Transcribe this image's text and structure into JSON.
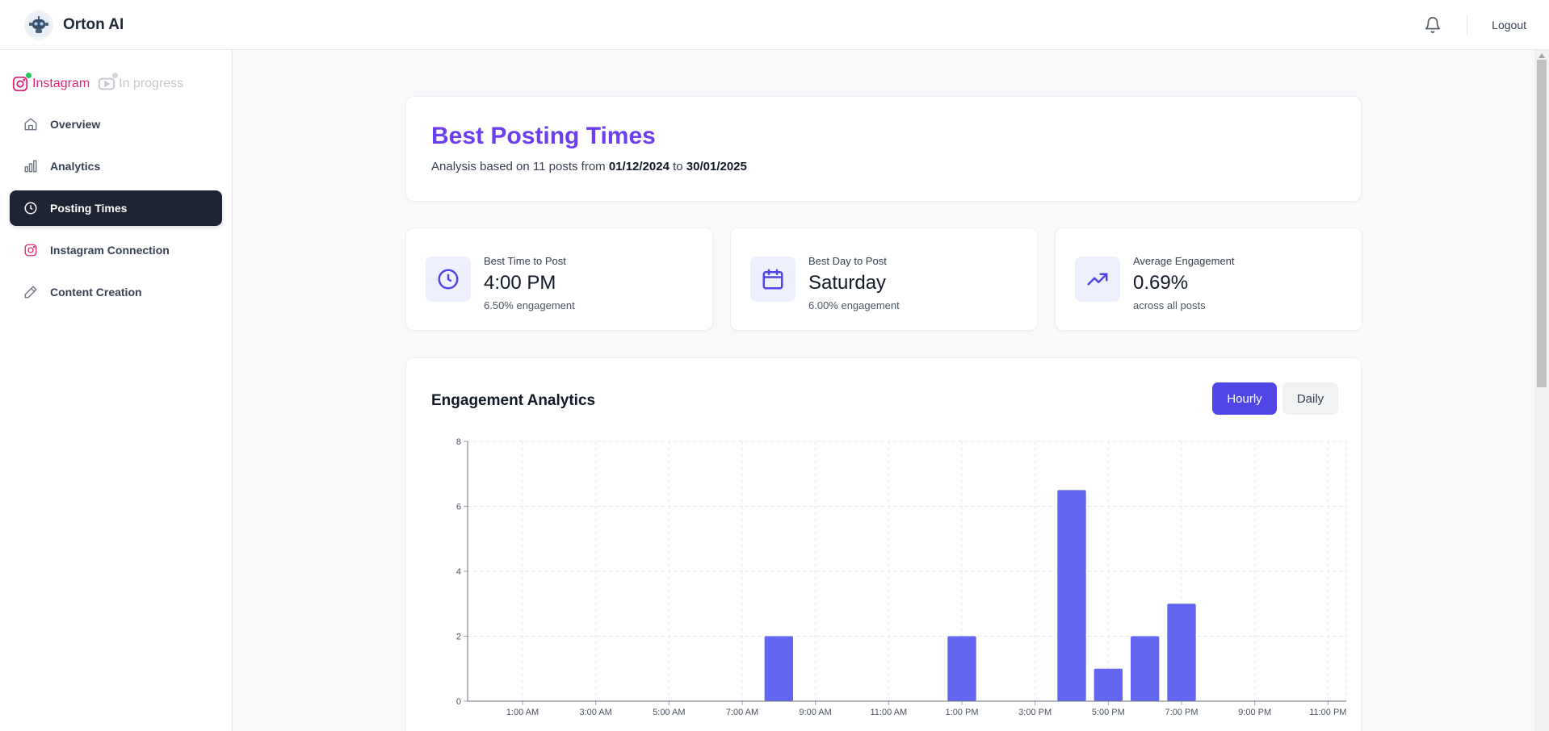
{
  "app": {
    "name": "Orton AI"
  },
  "topbar": {
    "logout_label": "Logout",
    "bell_icon": "bell-icon"
  },
  "sidebar": {
    "platforms": [
      {
        "label": "Instagram",
        "status_color": "#22c55e",
        "color": "#db2777"
      },
      {
        "label": "In progress",
        "status_color": "#d1d5db",
        "color": "#c4c7cd"
      }
    ],
    "items": [
      {
        "label": "Overview",
        "icon": "home-icon"
      },
      {
        "label": "Analytics",
        "icon": "bar-chart-icon"
      },
      {
        "label": "Posting Times",
        "icon": "clock-icon",
        "active": true
      },
      {
        "label": "Instagram Connection",
        "icon": "instagram-icon"
      },
      {
        "label": "Content Creation",
        "icon": "pencil-icon"
      }
    ]
  },
  "header": {
    "title": "Best Posting Times",
    "subtitle_prefix": "Analysis based on 11 posts from",
    "date_from": "01/12/2024",
    "subtitle_mid": "to",
    "date_to": "30/01/2025"
  },
  "stats": [
    {
      "label": "Best Time to Post",
      "value": "4:00 PM",
      "sub": "6.50% engagement",
      "icon": "clock-icon"
    },
    {
      "label": "Best Day to Post",
      "value": "Saturday",
      "sub": "6.00% engagement",
      "icon": "calendar-icon"
    },
    {
      "label": "Average Engagement",
      "value": "0.69%",
      "sub": "across all posts",
      "icon": "trending-up-icon"
    }
  ],
  "analytics": {
    "title": "Engagement Analytics",
    "toggle": {
      "hourly_label": "Hourly",
      "daily_label": "Daily",
      "selected": "Hourly"
    }
  },
  "colors": {
    "accent": "#4f46e5",
    "bar": "#6366f1",
    "title": "#6d3ef0",
    "active_nav": "#1e2433"
  },
  "chart_data": {
    "type": "bar",
    "categories": [
      "12:00 AM",
      "1:00 AM",
      "2:00 AM",
      "3:00 AM",
      "4:00 AM",
      "5:00 AM",
      "6:00 AM",
      "7:00 AM",
      "8:00 AM",
      "9:00 AM",
      "10:00 AM",
      "11:00 AM",
      "12:00 PM",
      "1:00 PM",
      "2:00 PM",
      "3:00 PM",
      "4:00 PM",
      "5:00 PM",
      "6:00 PM",
      "7:00 PM",
      "8:00 PM",
      "9:00 PM",
      "10:00 PM",
      "11:00 PM"
    ],
    "tick_labels": [
      "1:00 AM",
      "3:00 AM",
      "5:00 AM",
      "7:00 AM",
      "9:00 AM",
      "11:00 AM",
      "1:00 PM",
      "3:00 PM",
      "5:00 PM",
      "7:00 PM",
      "9:00 PM",
      "11:00 PM"
    ],
    "values": [
      0,
      0,
      0,
      0,
      0,
      0,
      0,
      0,
      2,
      0,
      0,
      0,
      0,
      2,
      0,
      0,
      6.5,
      1,
      2,
      3,
      0,
      0,
      0,
      0
    ],
    "yticks": [
      0,
      2,
      4,
      6,
      8
    ],
    "ylim": [
      0,
      8
    ],
    "grid": true,
    "xlabel": "",
    "ylabel": ""
  }
}
